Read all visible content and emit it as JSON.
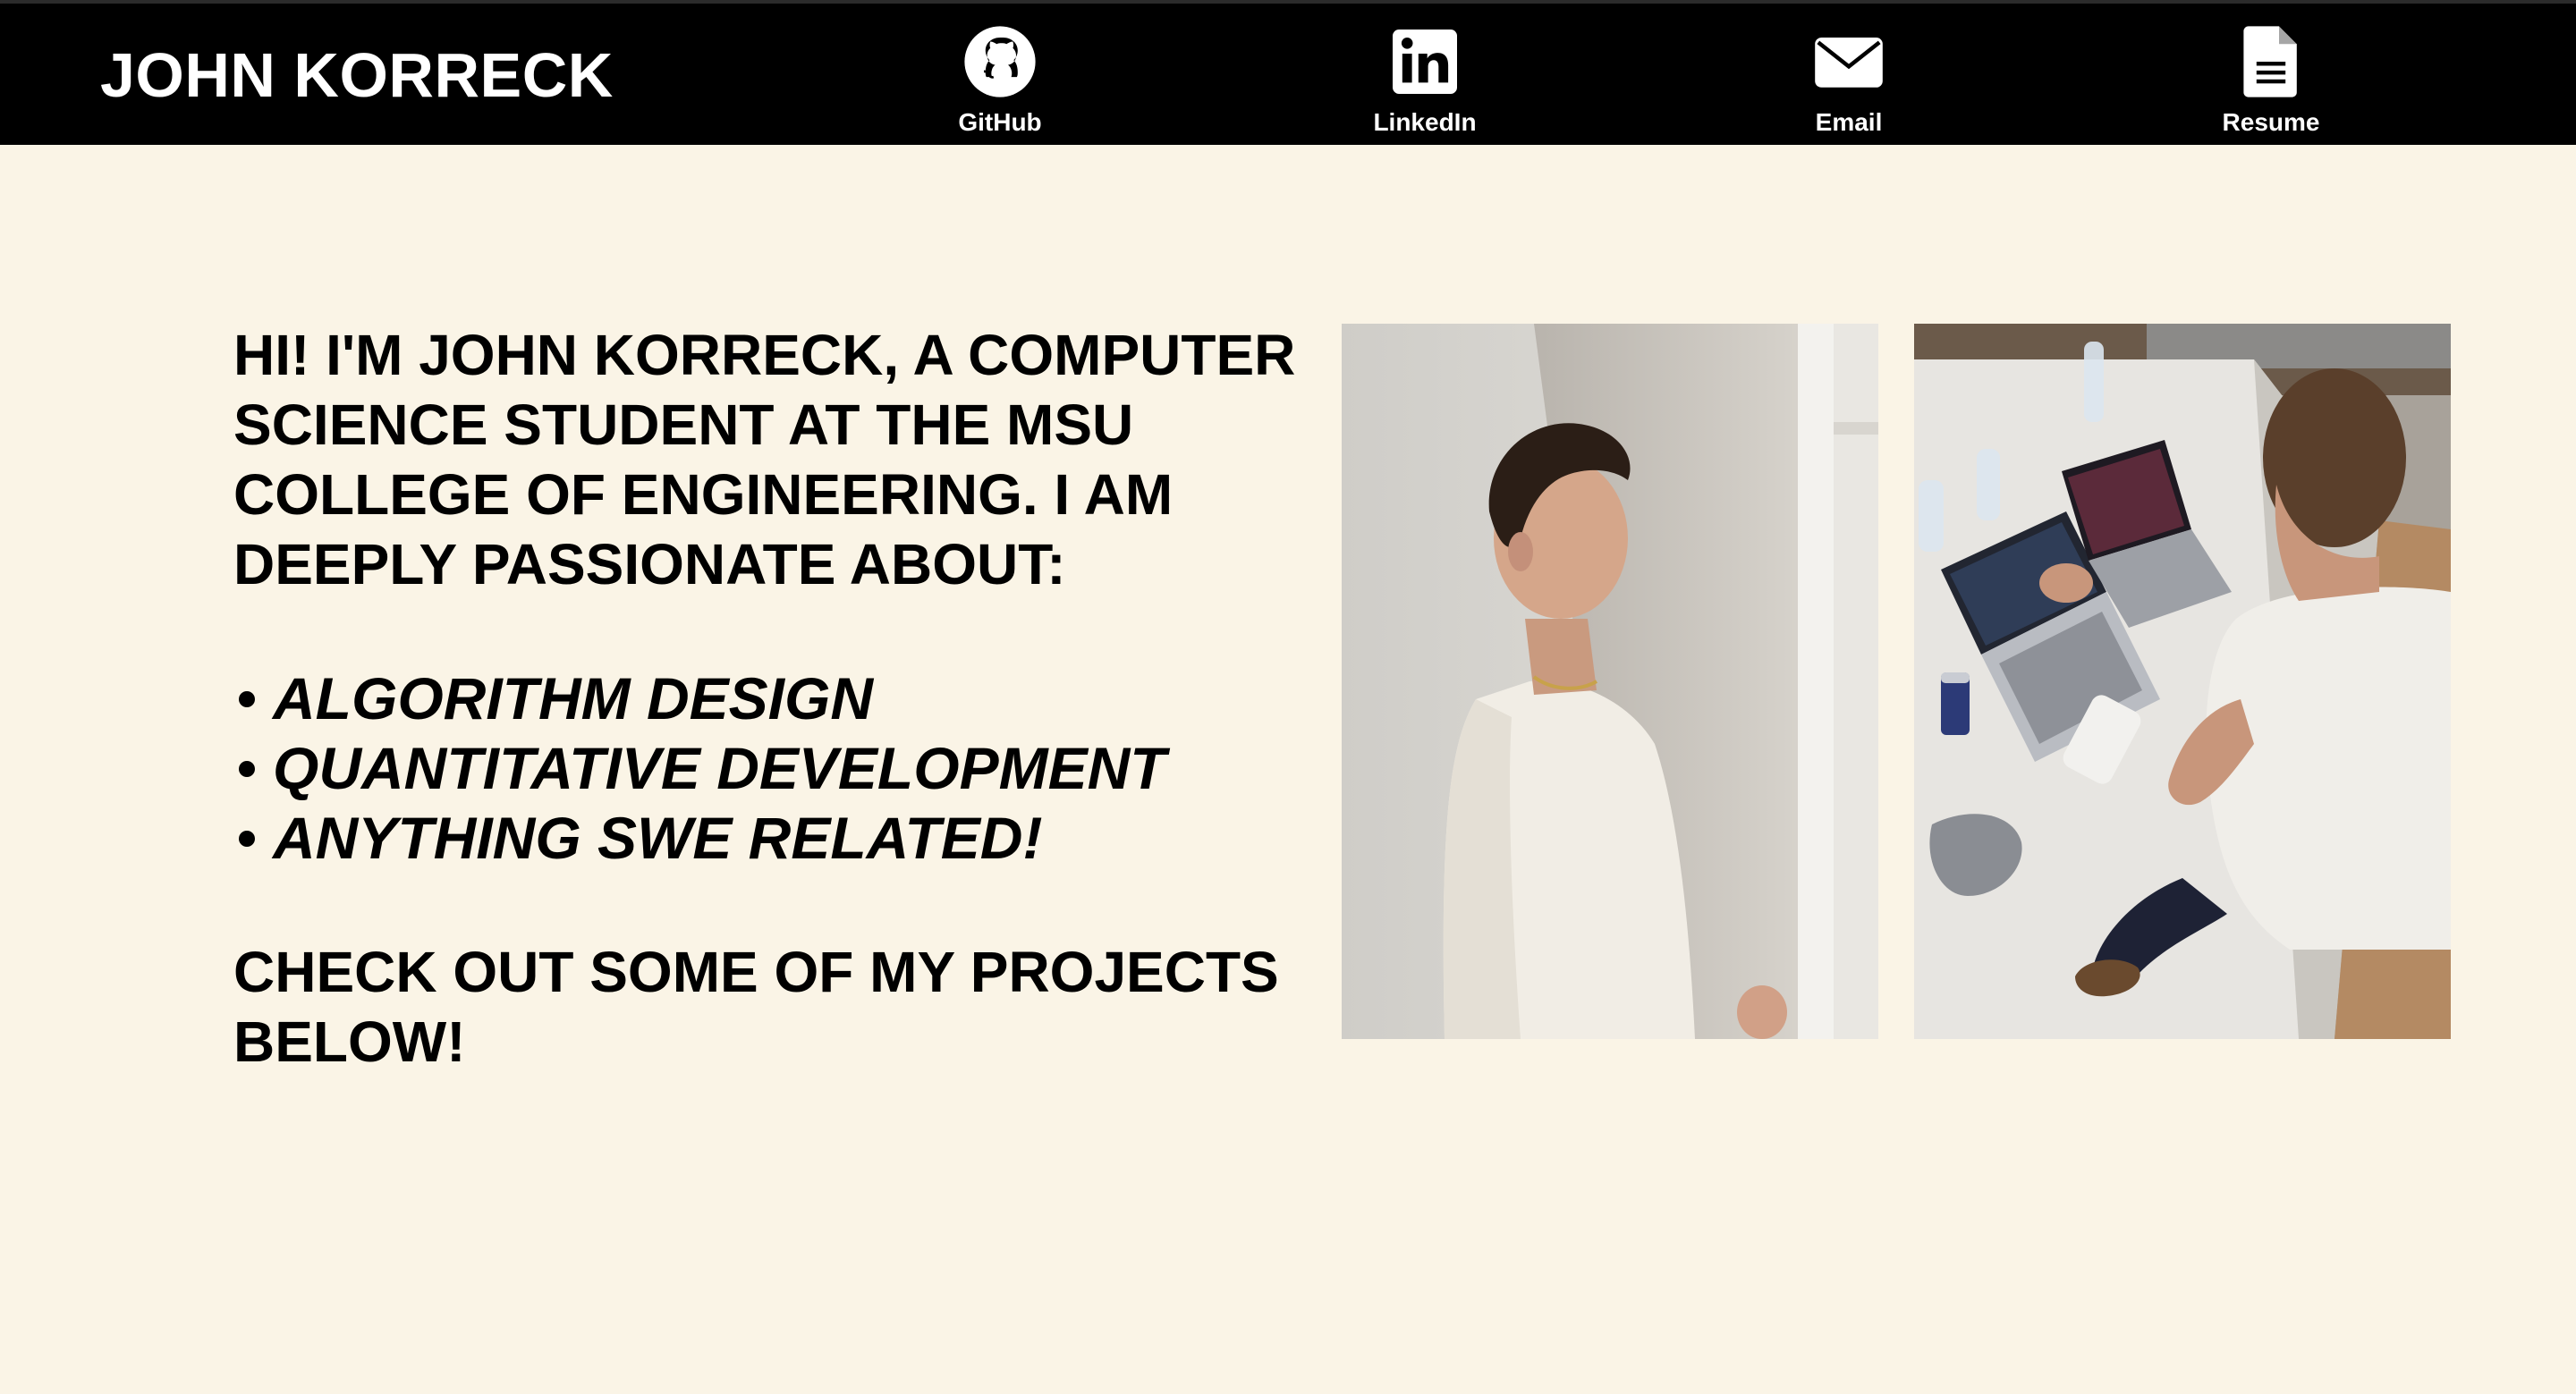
{
  "header": {
    "brand": "JOHN KORRECK",
    "links": [
      {
        "label": "GitHub",
        "icon": "github-icon"
      },
      {
        "label": "LinkedIn",
        "icon": "linkedin-icon"
      },
      {
        "label": "Email",
        "icon": "envelope-icon"
      },
      {
        "label": "Resume",
        "icon": "document-icon"
      }
    ]
  },
  "hero": {
    "intro": "HI! I'M JOHN KORRECK, A COMPUTER SCIENCE STUDENT AT THE MSU COLLEGE OF ENGINEERING. I AM DEEPLY PASSIONATE ABOUT:",
    "passions": [
      "ALGORITHM DESIGN",
      "QUANTITATIVE DEVELOPMENT",
      "ANYTHING SWE RELATED!"
    ],
    "cta": "CHECK OUT SOME OF MY PROJECTS BELOW!"
  },
  "photos": [
    {
      "subject": "portrait-photo"
    },
    {
      "subject": "coding-photo"
    }
  ],
  "colors": {
    "background": "#faf4e6",
    "header": "#000000",
    "text": "#000000",
    "header_text": "#ffffff"
  }
}
